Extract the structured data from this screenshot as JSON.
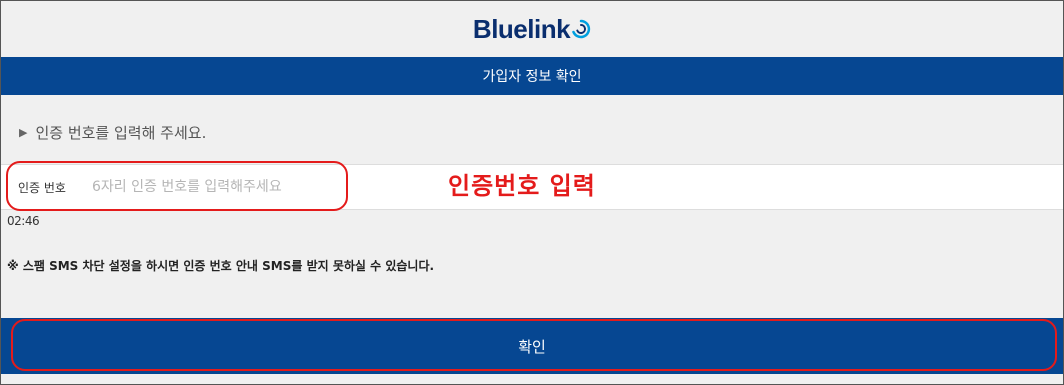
{
  "header": {
    "logo_blue": "Blue",
    "logo_link": "link"
  },
  "titlebar": {
    "title": "가입자 정보 확인"
  },
  "instruction": {
    "text": "인증 번호를 입력해 주세요."
  },
  "auth": {
    "label": "인증 번호",
    "value": "",
    "placeholder": "6자리 인증 번호를 입력해주세요"
  },
  "annotation": {
    "text": "인증번호 입력"
  },
  "timer": {
    "value": "02:46"
  },
  "notice": {
    "text": "※ 스팸 SMS 차단 설정을 하시면 인증 번호 안내 SMS를 받지 못하실 수 있습니다."
  },
  "confirm": {
    "label": "확인"
  },
  "colors": {
    "brand_blue": "#064792",
    "logo_navy": "#0a2e6e",
    "annotation_red": "#e41b1b"
  }
}
